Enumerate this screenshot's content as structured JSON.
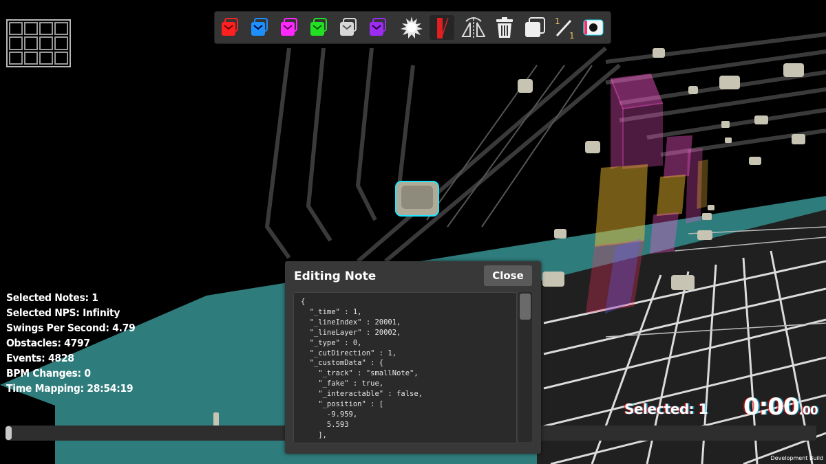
{
  "toolbar": {
    "tools": [
      {
        "name": "red-note-tool",
        "color": "#ff2020"
      },
      {
        "name": "blue-note-tool",
        "color": "#1e8fff"
      },
      {
        "name": "magenta-note-tool",
        "color": "#ff28ff"
      },
      {
        "name": "green-note-tool",
        "color": "#22e022"
      },
      {
        "name": "white-note-tool",
        "color": "#d8d8d8"
      },
      {
        "name": "purple-note-tool",
        "color": "#9b2cf0"
      },
      {
        "name": "bomb-tool",
        "icon": "bomb-icon"
      },
      {
        "name": "wall-tool",
        "icon": "wall-icon"
      },
      {
        "name": "mirror-tool",
        "icon": "mirror-icon"
      },
      {
        "name": "delete-tool",
        "icon": "trash-icon"
      },
      {
        "name": "copy-tool",
        "icon": "copy-icon"
      },
      {
        "name": "precision-tool",
        "icon": "fraction-icon",
        "top": "1",
        "bottom": "1"
      },
      {
        "name": "color-toggle-tool",
        "icon": "dot-icon"
      }
    ]
  },
  "stats": {
    "selected_notes": "Selected Notes: 1",
    "selected_nps": "Selected NPS: Infinity",
    "swings_per_second": "Swings Per Second: 4.79",
    "obstacles": "Obstacles: 4797",
    "events": "Events: 4828",
    "bpm_changes": "BPM Changes: 0",
    "time_mapping": "Time Mapping: 28:54:19"
  },
  "status": {
    "selected": "Selected: 1",
    "timer_main": "0:00",
    "timer_ms": ".00",
    "dev_build": "Development Build"
  },
  "timeline": {
    "progress": 0.0
  },
  "dialog": {
    "title": "Editing Note",
    "close_label": "Close",
    "json_text": "{\n  \"_time\" : 1,\n  \"_lineIndex\" : 20001,\n  \"_lineLayer\" : 20002,\n  \"_type\" : 0,\n  \"_cutDirection\" : 1,\n  \"_customData\" : {\n    \"_track\" : \"smallNote\",\n    \"_fake\" : true,\n    \"_interactable\" : false,\n    \"_position\" : [\n      -9.959,\n      5.593\n    ],"
  },
  "colors": {
    "floor": "#3fa6a6",
    "wall_pink": "#ff5ad2",
    "wall_yellow": "#ffc832",
    "selection_outline": "#1ee6ff"
  }
}
